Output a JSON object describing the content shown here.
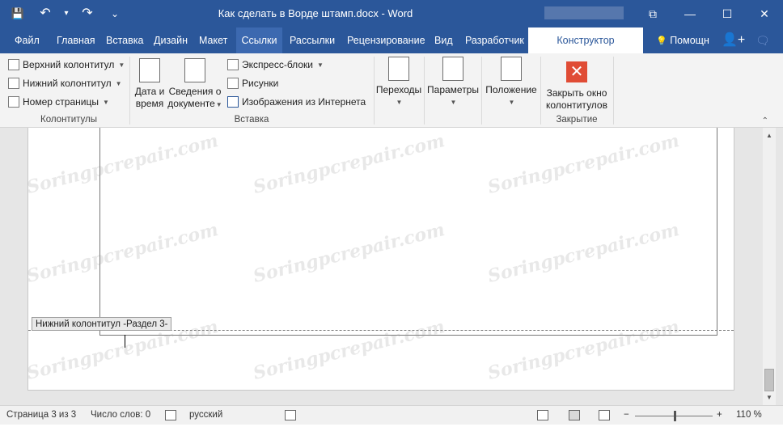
{
  "window": {
    "title": "Как сделать в Ворде штамп.docx - Word",
    "controls": {
      "ribbon_options": "⧉",
      "minimize": "—",
      "maximize": "☐",
      "close": "✕"
    },
    "qat": {
      "save": "💾",
      "undo": "↶",
      "undo_caret": "▾",
      "redo": "↷",
      "customize": "⌄"
    }
  },
  "tabs": [
    {
      "label": "Файл"
    },
    {
      "label": "Главная"
    },
    {
      "label": "Вставка"
    },
    {
      "label": "Дизайн"
    },
    {
      "label": "Макет"
    },
    {
      "label": "Ссылки"
    },
    {
      "label": "Рассылки"
    },
    {
      "label": "Рецензирование"
    },
    {
      "label": "Вид"
    },
    {
      "label": "Разработчик"
    },
    {
      "label": "Конструктор"
    }
  ],
  "help": {
    "label": "Помощн",
    "icon": "💡"
  },
  "share_icon": "👤+",
  "comment_icon": "🗨",
  "ribbon": {
    "groups": {
      "kolontituly": {
        "label": "Колонтитулы",
        "items": [
          "Верхний колонтитул",
          "Нижний колонтитул",
          "Номер страницы"
        ]
      },
      "vstavka": {
        "label": "Вставка",
        "date_time": [
          "Дата и",
          "время"
        ],
        "doc_info": [
          "Сведения о",
          "документе"
        ],
        "items": [
          "Экспресс-блоки",
          "Рисунки",
          "Изображения из Интернета"
        ]
      },
      "navigation": {
        "perehody": "Переходы",
        "parametry": "Параметры",
        "polozhenie": "Положение"
      },
      "zakrytie": {
        "label": "Закрытие",
        "close_btn": [
          "Закрыть окно",
          "колонтитулов"
        ]
      }
    },
    "collapse": "⌃"
  },
  "document": {
    "footer_tag": "Нижний колонтитул -Раздел 3-"
  },
  "scroll": {
    "up": "▲",
    "down": "▼"
  },
  "status": {
    "page": "Страница 3 из 3",
    "words": "Число слов: 0",
    "lang": "русский",
    "zoom_minus": "−",
    "zoom_plus": "+",
    "zoom": "110 %",
    "zoom_level": 110
  },
  "watermark": "Soringpcrepair.com",
  "colors": {
    "brand": "#2b579a",
    "close_red": "#e04c35"
  }
}
